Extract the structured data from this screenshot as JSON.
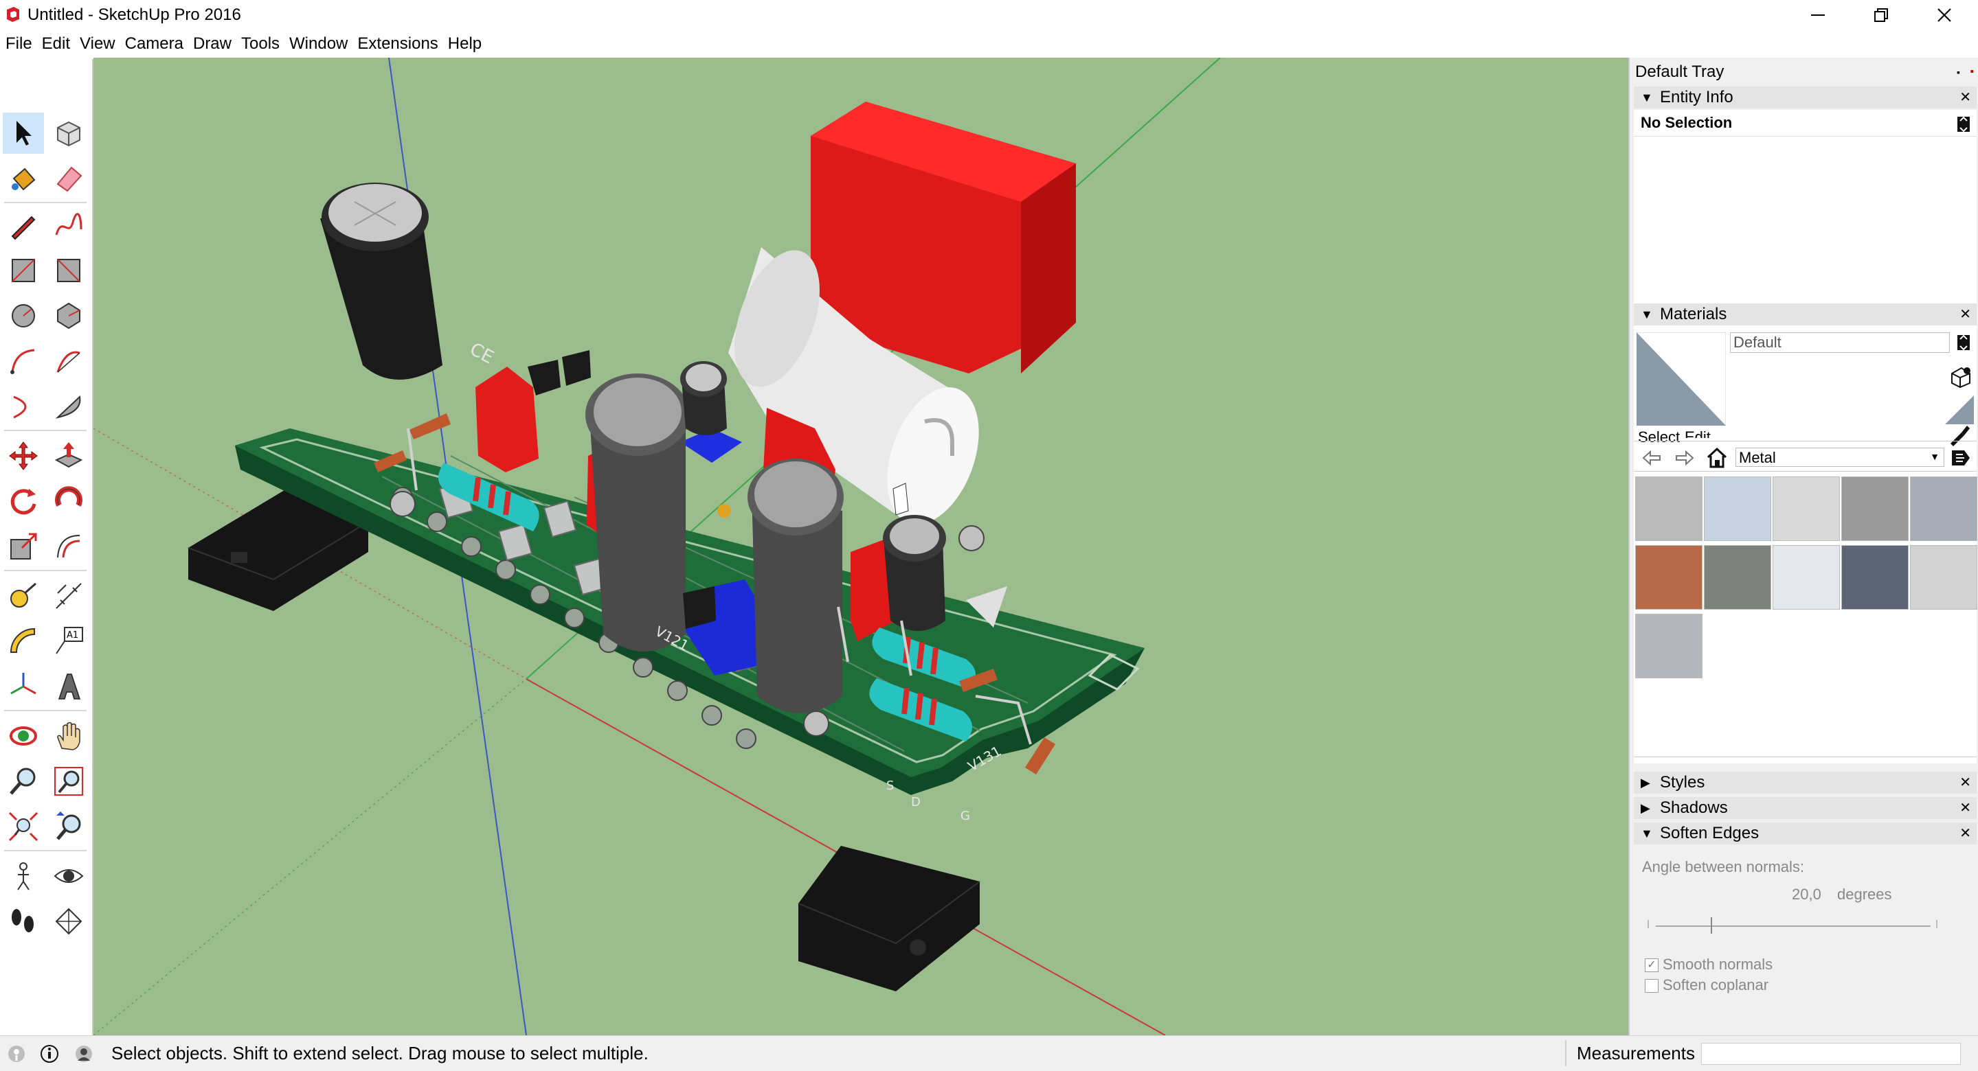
{
  "window": {
    "title": "Untitled - SketchUp Pro 2016"
  },
  "menu": [
    "File",
    "Edit",
    "View",
    "Camera",
    "Draw",
    "Tools",
    "Window",
    "Extensions",
    "Help"
  ],
  "tray": {
    "title": "Default Tray",
    "entity_info": {
      "title": "Entity Info",
      "selection": "No Selection"
    },
    "materials": {
      "title": "Materials",
      "name_value": "Default",
      "tab_select": "Select",
      "tab_edit": "Edit",
      "library": "Metal",
      "swatch_colors": [
        "#b9b9b9",
        "#c6d3e2",
        "#d9d9d9",
        "#9a9a9a",
        "#a5acb3",
        "#b86a48",
        "#7d827c",
        "#e6e7ee",
        "#5c6475",
        "#d2d2d2",
        "#b4b8bc"
      ]
    },
    "styles": {
      "title": "Styles"
    },
    "shadows": {
      "title": "Shadows"
    },
    "soften_edges": {
      "title": "Soften Edges",
      "angle_label": "Angle between normals:",
      "angle_value": "20,0",
      "angle_unit": "degrees",
      "angle_slider": 0.2,
      "smooth_normals": "Smooth normals",
      "smooth_checked": true,
      "soften_coplanar": "Soften coplanar",
      "coplanar_checked": false
    }
  },
  "status": {
    "hint": "Select objects. Shift to extend select. Drag mouse to select multiple.",
    "measurements_label": "Measurements",
    "measurements_value": ""
  },
  "viewport": {
    "background": "#9bbd8e",
    "board_text": [
      "CE",
      "V121",
      "V131",
      "S",
      "D",
      "G"
    ]
  }
}
